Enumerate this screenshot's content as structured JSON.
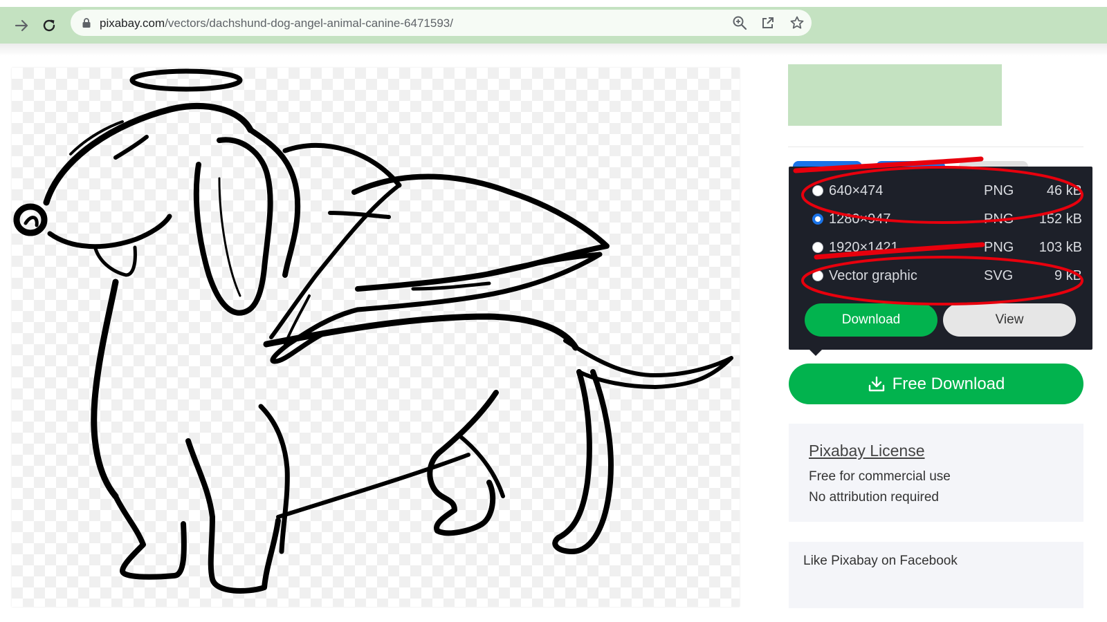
{
  "browser": {
    "url_host": "pixabay.com",
    "url_path": "/vectors/dachshund-dog-angel-animal-canine-6471593/",
    "icons": [
      "back-arrow-icon",
      "reload-icon",
      "lock-icon",
      "zoom-icon",
      "share-icon",
      "star-icon"
    ]
  },
  "preview": {
    "image": "dachshund-angel-line-art"
  },
  "download_panel": {
    "options": [
      {
        "resolution": "640×474",
        "format": "PNG",
        "size": "46 kB",
        "selected": false
      },
      {
        "resolution": "1280×947",
        "format": "PNG",
        "size": "152 kB",
        "selected": true
      },
      {
        "resolution": "1920×1421",
        "format": "PNG",
        "size": "103 kB",
        "selected": false
      },
      {
        "resolution": "Vector graphic",
        "format": "SVG",
        "size": "9 kB",
        "selected": false
      }
    ],
    "download_label": "Download",
    "view_label": "View"
  },
  "free_download": {
    "label": "Free Download",
    "icon": "download-icon"
  },
  "license": {
    "title": "Pixabay License",
    "line1": "Free for commercial use",
    "line2": "No attribution required"
  },
  "facebook": {
    "text": "Like Pixabay on Facebook"
  },
  "colors": {
    "browser_bar": "#c4e2c1",
    "accent_green": "#02b34e",
    "panel_bg": "#1d2029",
    "annotation_red": "#e8000d"
  }
}
